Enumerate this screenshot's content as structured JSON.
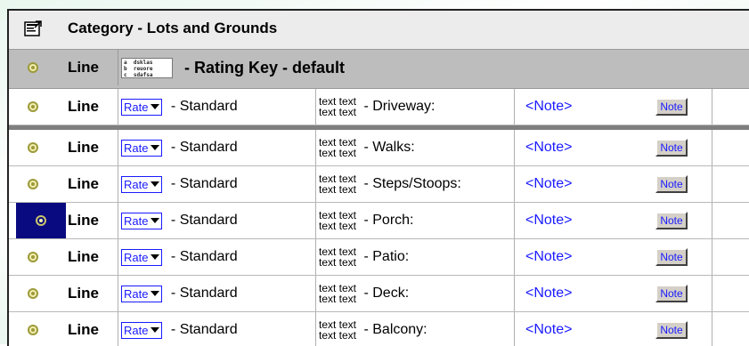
{
  "category": {
    "title": "Category - Lots and Grounds"
  },
  "rating_key": {
    "line_label": "Line",
    "key_lines": [
      "a  dsklas",
      "b  reuore",
      "c  sdafsa"
    ],
    "title": " - Rating Key - default"
  },
  "rows": [
    {
      "line": "Line",
      "rate_label": "Rate",
      "standard": " - Standard",
      "item_stack": [
        "text text",
        "text text"
      ],
      "item_name": " - Driveway:",
      "note_link": "<Note>",
      "note_btn": "Note"
    },
    {
      "line": "Line",
      "rate_label": "Rate",
      "standard": " - Standard",
      "item_stack": [
        "text text",
        "text text"
      ],
      "item_name": " - Walks:",
      "note_link": "<Note>",
      "note_btn": "Note"
    },
    {
      "line": "Line",
      "rate_label": "Rate",
      "standard": " - Standard",
      "item_stack": [
        "text text",
        "text text"
      ],
      "item_name": " - Steps/Stoops:",
      "note_link": "<Note>",
      "note_btn": "Note"
    },
    {
      "line": "Line",
      "rate_label": "Rate",
      "standard": " - Standard",
      "item_stack": [
        "text text",
        "text text"
      ],
      "item_name": " - Porch:",
      "note_link": "<Note>",
      "note_btn": "Note"
    },
    {
      "line": "Line",
      "rate_label": "Rate",
      "standard": " - Standard",
      "item_stack": [
        "text text",
        "text text"
      ],
      "item_name": " - Patio:",
      "note_link": "<Note>",
      "note_btn": "Note"
    },
    {
      "line": "Line",
      "rate_label": "Rate",
      "standard": " - Standard",
      "item_stack": [
        "text text",
        "text text"
      ],
      "item_name": " - Deck:",
      "note_link": "<Note>",
      "note_btn": "Note"
    },
    {
      "line": "Line",
      "rate_label": "Rate",
      "standard": " - Standard",
      "item_stack": [
        "text text",
        "text text"
      ],
      "item_name": " - Balcony:",
      "note_link": "<Note>",
      "note_btn": "Note"
    }
  ],
  "icons": {
    "category": "properties-icon",
    "line": "target-icon",
    "rate_dropdown": "chevron-down-icon"
  },
  "colors": {
    "link": "#1a1aff",
    "selected": "#0a0a80",
    "key_row_bg": "#bdbdbd",
    "separator": "#7f7f7f"
  }
}
